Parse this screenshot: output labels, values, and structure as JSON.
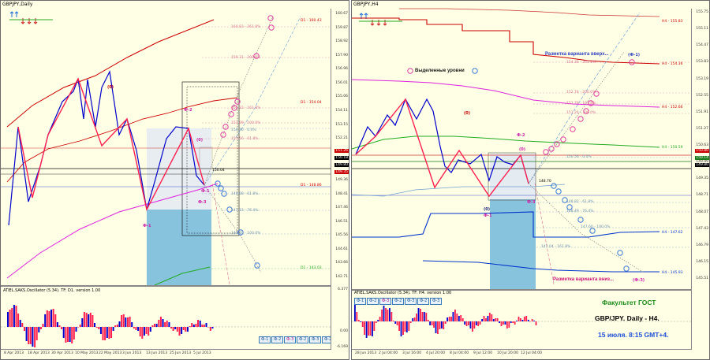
{
  "left": {
    "title": "GBPJPY,Daily",
    "price_labels": [
      "160.67",
      "159.87",
      "158.92",
      "157.90",
      "156.96",
      "156.01",
      "155.06",
      "154.11",
      "153.15",
      "152.21",
      "151.26",
      "150.31",
      "149.36",
      "148.41",
      "147.46",
      "146.51",
      "145.56",
      "144.61",
      "143.66",
      "142.71"
    ],
    "price_tags": [
      {
        "text": "151.26",
        "kind": "red"
      },
      {
        "text": "150.18",
        "kind": "black"
      },
      {
        "text": "149.80",
        "kind": "black"
      },
      {
        "text": "149.35",
        "kind": "red"
      }
    ],
    "levels": [
      {
        "text": "D1 - 160.43",
        "color": "#cc0000"
      },
      {
        "text": "160.83 - 261.8%",
        "color": "#d87090"
      },
      {
        "text": "159.31 - 200.0%",
        "color": "#d87090"
      },
      {
        "text": "D1 - 154.04",
        "color": "#cc0000"
      },
      {
        "text": "155.22 - 161.8%",
        "color": "#d87090"
      },
      {
        "text": "153.09 - 100.0%",
        "color": "#d87090"
      },
      {
        "text": "151.56 - 61.8%",
        "color": "#d87090"
      },
      {
        "text": "150.36 - 0.0%",
        "color": "#6a8fb0"
      },
      {
        "text": "150.04",
        "color": "#000000"
      },
      {
        "text": "D1 - 148.86",
        "color": "#cc0000"
      },
      {
        "text": "148.08 - 61.8%",
        "color": "#6a8fb0"
      },
      {
        "text": "147.33 - 76.4%",
        "color": "#6a8fb0"
      },
      {
        "text": "145.40 - 100.0%",
        "color": "#6a8fb0"
      },
      {
        "text": "D1 - 143.03",
        "color": "#22aa22"
      }
    ],
    "wave_labels": [
      "(0)",
      "Ф-2",
      "(0)",
      "Ф-1",
      "Ф-3",
      "Ф-1"
    ],
    "osc_title": "ATIEL.SAKS.Oscillator (5.34). TF: D1. version 1.00",
    "osc_scale": [
      "6.377",
      "0.00",
      "-6.169"
    ],
    "buttons": [
      "Ф-1",
      "Ф-2",
      "Ф-3",
      "Ф-2",
      "Ф-3",
      "Ф-2"
    ],
    "dates": [
      "8 Apr 2013",
      "18 Apr 2013",
      "30 Apr 2013",
      "10 May 2013",
      "22 May 2013",
      "3 Jun 2013",
      "13 Jun 2013",
      "25 Jun 2013",
      "5 Jul 2013"
    ]
  },
  "right": {
    "title": "GBPJPY,H4",
    "price_labels": [
      "155.75",
      "155.11",
      "154.47",
      "153.83",
      "153.19",
      "152.55",
      "151.91",
      "151.27",
      "150.63",
      "149.99",
      "149.35",
      "148.71",
      "148.07",
      "147.43",
      "146.79",
      "146.15",
      "145.51"
    ],
    "price_tags": [
      {
        "text": "150.80",
        "kind": "red"
      },
      {
        "text": "150.14",
        "kind": "green"
      },
      {
        "text": "149.80",
        "kind": "black"
      }
    ],
    "levels": [
      {
        "text": "H4 - 155.83",
        "color": "#cc0000"
      },
      {
        "text": "H4 - 154.36",
        "color": "#cc0000"
      },
      {
        "text": "154.36 - 261.8%",
        "color": "#d87090"
      },
      {
        "text": "152.74 - 200.0%",
        "color": "#d87090"
      },
      {
        "text": "H4 - 152.66",
        "color": "#cc0000"
      },
      {
        "text": "151.78 - 161.8%",
        "color": "#d87090"
      },
      {
        "text": "151.24 - 100.0%",
        "color": "#d87090"
      },
      {
        "text": "H4 - 150.59",
        "color": "#22aa22"
      },
      {
        "text": "150.56 - 0.0%",
        "color": "#6a8fb0"
      },
      {
        "text": "148.70",
        "color": "#000000"
      },
      {
        "text": "148.82 - 61.8%",
        "color": "#6a8fb0"
      },
      {
        "text": "148.49 - 76.4%",
        "color": "#6a8fb0"
      },
      {
        "text": "147.60 - 100.0%",
        "color": "#6a8fb0"
      },
      {
        "text": "H4 - 147.62",
        "color": "#0033cc"
      },
      {
        "text": "147.04 - 161.8%",
        "color": "#6a8fb0"
      },
      {
        "text": "H4 - 145.93",
        "color": "#0033cc"
      }
    ],
    "wave_labels": [
      "(0)",
      "Ф-2",
      "(0)",
      "(0)",
      "Ф-1",
      "Ф-3",
      "(Ф-1)",
      "(Ф-3)"
    ],
    "annotation_up": "Разметка варианта вверх...",
    "annotation_down": "Разметка варианта вниз...",
    "annotation_levels": "Выделенные уровни",
    "osc_title": "ATIEL.SAKS.Oscillator (5.34). TF: H4. version 1.00",
    "buttons": [
      "Ф-1",
      "Ф-2",
      "Ф-3",
      "Ф-2",
      "Ф-3",
      "Ф-2",
      "Ф-3"
    ],
    "dates": [
      "28 Jun 2013",
      "2 Jul 04:00",
      "3 Jul 16:00",
      "4 Jul 20:00",
      "8 Jul 04:00",
      "9 Jul 12:00",
      "10 Jul 20:00",
      "12 Jul 04:00"
    ],
    "faculty": "Факультет ГОСТ",
    "pair_info": "GBP/JPY. Daily - H4.",
    "date_info": "15 июля. 8:15 GMT+4."
  },
  "colors": {
    "background": "#ffffe6",
    "bull": "#0000cc",
    "bear": "#ff2050",
    "ma_red": "#cc0000",
    "ma_magenta": "#dd22dd",
    "ma_green": "#22aa22",
    "fibo": "#d87090",
    "box_blue": "#87c3dd"
  }
}
